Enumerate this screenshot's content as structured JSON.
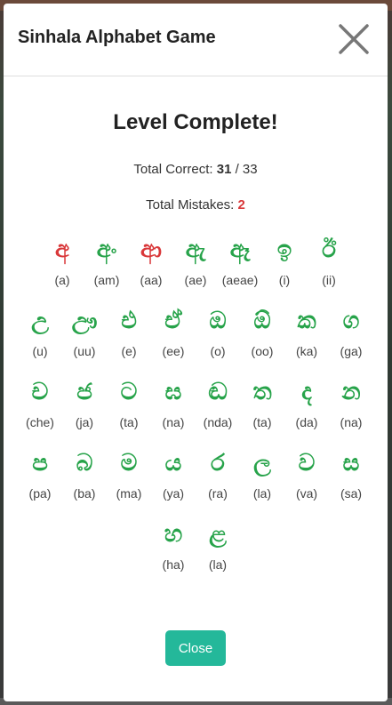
{
  "modal": {
    "title": "Sinhala Alphabet Game",
    "heading": "Level Complete!",
    "correct_label": "Total Correct:",
    "correct_value": "31",
    "correct_total": "/ 33",
    "mistakes_label": "Total Mistakes:",
    "mistakes_value": "2",
    "close_label": "Close",
    "close_icon": "close-icon"
  },
  "colors": {
    "correct": "#27a34a",
    "wrong": "#d9383a",
    "button": "#24b89a"
  },
  "letters": [
    [
      {
        "glyph": "අ",
        "roman": "(a)",
        "status": "wrong"
      },
      {
        "glyph": "අං",
        "roman": "(am)",
        "status": "correct"
      },
      {
        "glyph": "ආ",
        "roman": "(aa)",
        "status": "wrong"
      },
      {
        "glyph": "ඇ",
        "roman": "(ae)",
        "status": "correct"
      },
      {
        "glyph": "ඈ",
        "roman": "(aeae)",
        "status": "correct"
      },
      {
        "glyph": "ඉ",
        "roman": "(i)",
        "status": "correct"
      },
      {
        "glyph": "ඊ",
        "roman": "(ii)",
        "status": "correct"
      }
    ],
    [
      {
        "glyph": "උ",
        "roman": "(u)",
        "status": "correct"
      },
      {
        "glyph": "ඌ",
        "roman": "(uu)",
        "status": "correct"
      },
      {
        "glyph": "එ",
        "roman": "(e)",
        "status": "correct"
      },
      {
        "glyph": "ඒ",
        "roman": "(ee)",
        "status": "correct"
      },
      {
        "glyph": "ඔ",
        "roman": "(o)",
        "status": "correct"
      },
      {
        "glyph": "ඕ",
        "roman": "(oo)",
        "status": "correct"
      },
      {
        "glyph": "ක",
        "roman": "(ka)",
        "status": "correct"
      },
      {
        "glyph": "ග",
        "roman": "(ga)",
        "status": "correct"
      }
    ],
    [
      {
        "glyph": "ච",
        "roman": "(che)",
        "status": "correct"
      },
      {
        "glyph": "ජ",
        "roman": "(ja)",
        "status": "correct"
      },
      {
        "glyph": "ට",
        "roman": "(ta)",
        "status": "correct"
      },
      {
        "glyph": "ඝ",
        "roman": "(na)",
        "status": "correct"
      },
      {
        "glyph": "ඬ",
        "roman": "(nda)",
        "status": "correct"
      },
      {
        "glyph": "ත",
        "roman": "(ta)",
        "status": "correct"
      },
      {
        "glyph": "ද",
        "roman": "(da)",
        "status": "correct"
      },
      {
        "glyph": "න",
        "roman": "(na)",
        "status": "correct"
      }
    ],
    [
      {
        "glyph": "ප",
        "roman": "(pa)",
        "status": "correct"
      },
      {
        "glyph": "බ",
        "roman": "(ba)",
        "status": "correct"
      },
      {
        "glyph": "ම",
        "roman": "(ma)",
        "status": "correct"
      },
      {
        "glyph": "ය",
        "roman": "(ya)",
        "status": "correct"
      },
      {
        "glyph": "ර",
        "roman": "(ra)",
        "status": "correct"
      },
      {
        "glyph": "ල",
        "roman": "(la)",
        "status": "correct"
      },
      {
        "glyph": "ව",
        "roman": "(va)",
        "status": "correct"
      },
      {
        "glyph": "ස",
        "roman": "(sa)",
        "status": "correct"
      }
    ],
    [
      {
        "glyph": "හ",
        "roman": "(ha)",
        "status": "correct"
      },
      {
        "glyph": "ළ",
        "roman": "(la)",
        "status": "correct"
      }
    ]
  ]
}
